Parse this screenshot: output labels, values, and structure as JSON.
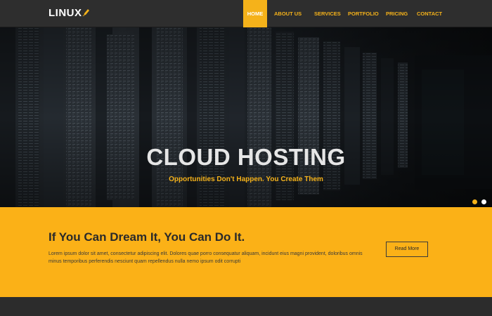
{
  "header": {
    "logo_text": "LINUX",
    "logo_icon": "pencil-mark-icon"
  },
  "nav": {
    "items": [
      {
        "label": "HOME",
        "active": true
      },
      {
        "label": "ABOUT US",
        "active": false
      },
      {
        "label": "SERVICES",
        "active": false
      },
      {
        "label": "PORTFOLIO",
        "active": false
      },
      {
        "label": "PRICING",
        "active": false
      },
      {
        "label": "CONTACT",
        "active": false
      }
    ]
  },
  "hero": {
    "title": "CLOUD HOSTING",
    "subtitle": "Opportunities Don't Happen. You Create Them",
    "background": "server-rack-photo",
    "slides": [
      {
        "active": true
      },
      {
        "active": false
      }
    ]
  },
  "banner": {
    "heading": "If You Can Dream It, You Can Do It.",
    "text": "Lorem ipsum dolor sit amet, consectetur adipiscing elit. Dolores quae porro consequatur aliquam, incidunt eius magni provident, doloribus omnis minus temporibus perferendis nesciunt quam repellendus nulla nemo ipsum odit corrupti",
    "button_label": "Read More"
  },
  "colors": {
    "accent": "#f5b21a",
    "banner_bg": "#fbb117",
    "header_bg": "#2e2e2e",
    "hero_title": "#e6e6e6"
  }
}
